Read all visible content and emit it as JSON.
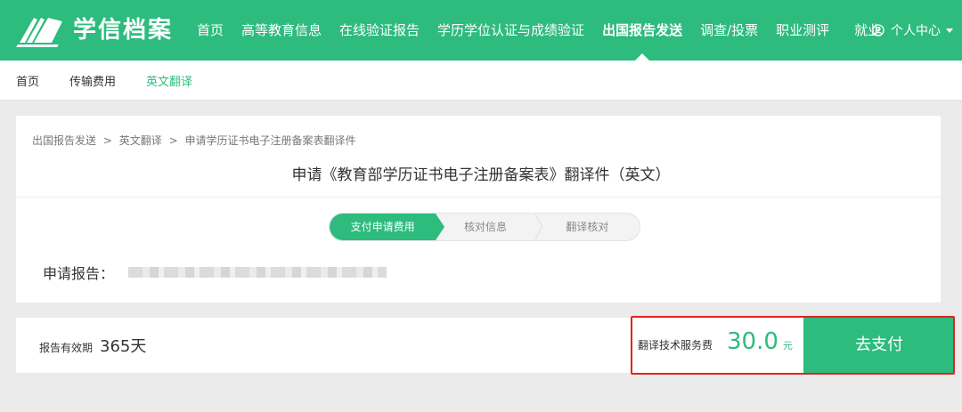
{
  "header": {
    "logo_text": "学信档案",
    "nav": [
      {
        "label": "首页"
      },
      {
        "label": "高等教育信息"
      },
      {
        "label": "在线验证报告"
      },
      {
        "label": "学历学位认证与成绩验证"
      },
      {
        "label": "出国报告发送",
        "active": true
      },
      {
        "label": "调查/投票"
      },
      {
        "label": "职业测评"
      },
      {
        "label": "就业"
      }
    ],
    "user_center": "个人中心"
  },
  "subnav": {
    "items": [
      {
        "label": "首页"
      },
      {
        "label": "传输费用"
      },
      {
        "label": "英文翻译",
        "active": true
      }
    ]
  },
  "main": {
    "breadcrumb": [
      "出国报告发送",
      ">",
      "英文翻译",
      ">",
      "申请学历证书电子注册备案表翻译件"
    ],
    "title": "申请《教育部学历证书电子注册备案表》翻译件（英文）",
    "steps": [
      "支付申请费用",
      "核对信息",
      "翻译核对"
    ],
    "report_label": "申请报告："
  },
  "payment": {
    "validity_label": "报告有效期",
    "validity_value": "365天",
    "fee_label": "翻译技术服务费",
    "fee_amount": "30.0",
    "fee_unit": "元",
    "pay_button": "去支付"
  },
  "colors": {
    "brand_green": "#2dbb7e",
    "highlight_red": "#e0241f"
  }
}
